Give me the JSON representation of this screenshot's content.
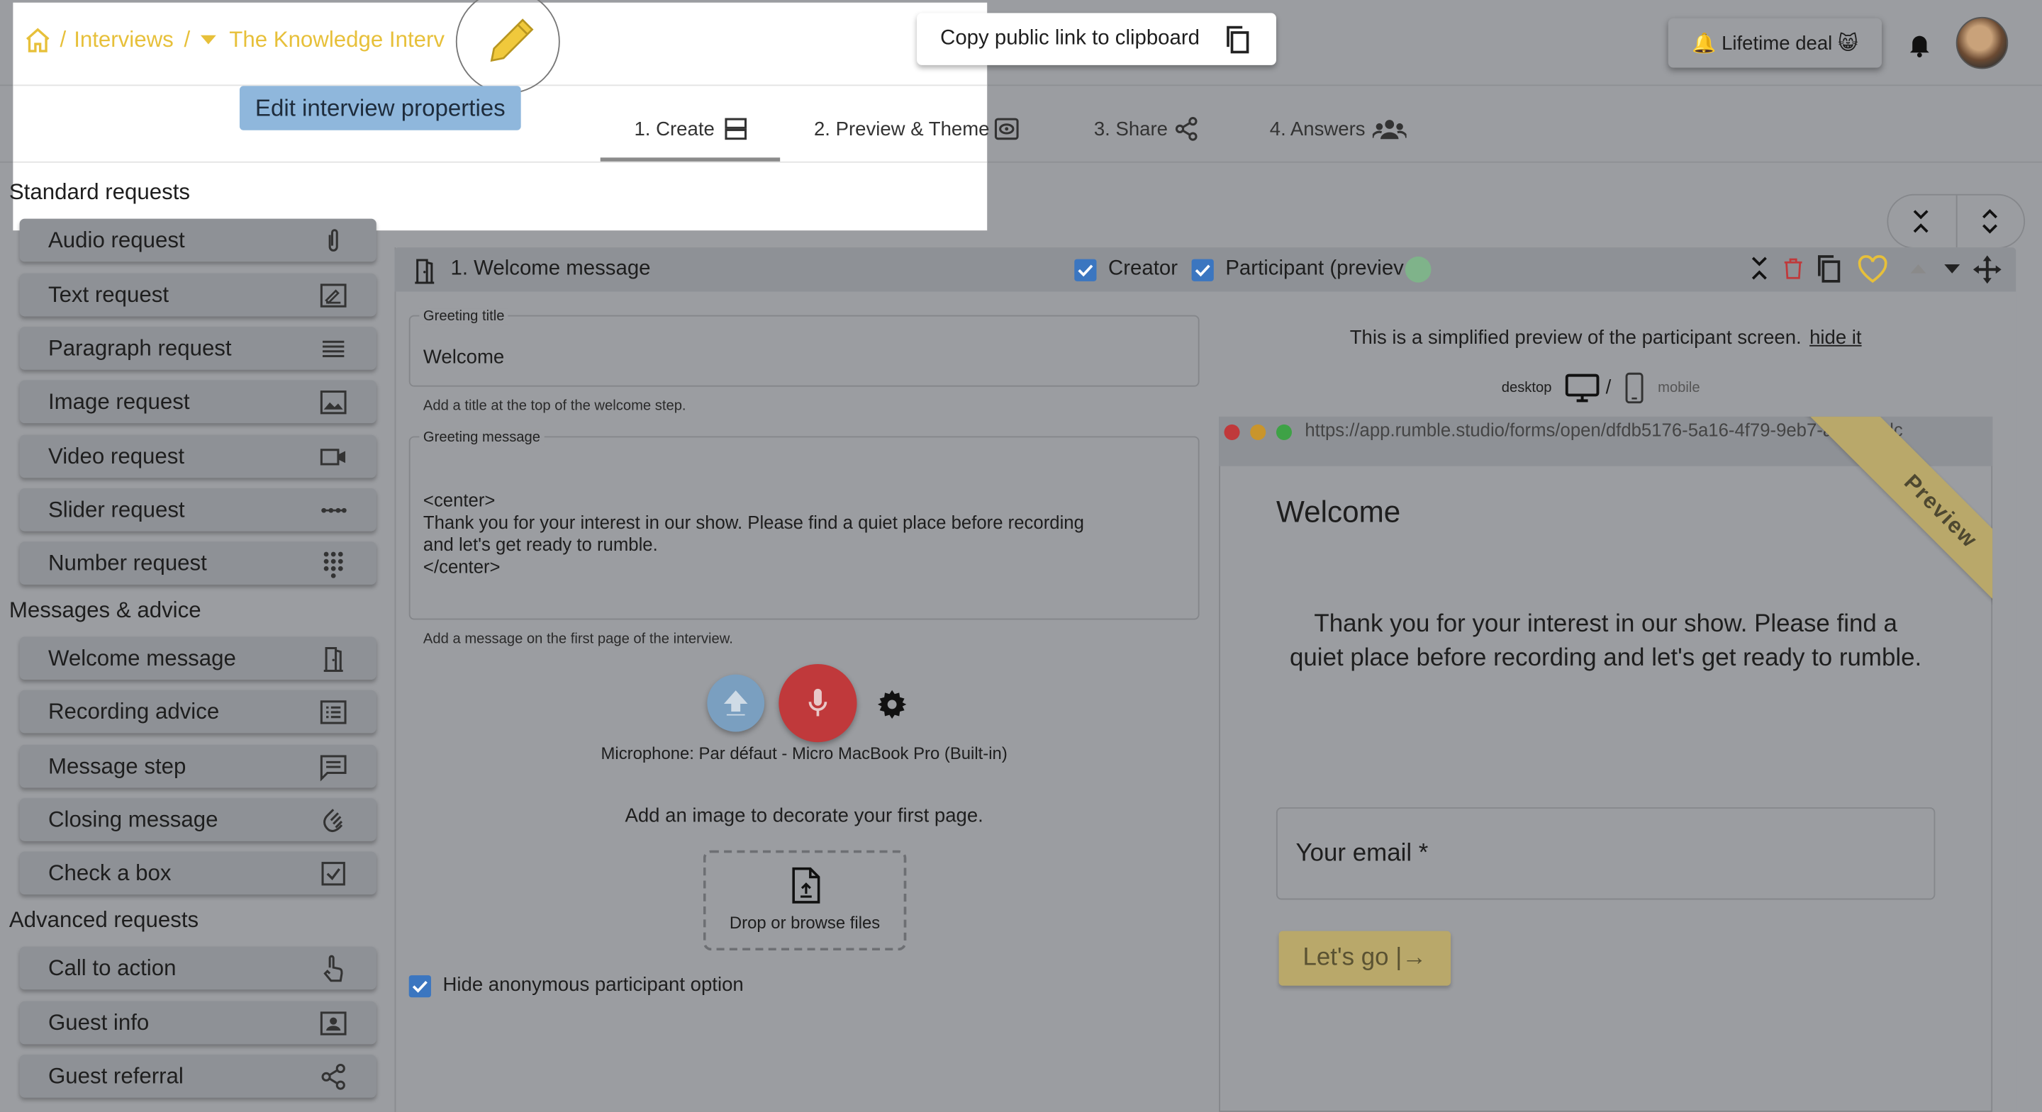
{
  "breadcrumb": {
    "home_icon": "home-icon",
    "interviews": "Interviews",
    "sep": "/",
    "current": "The Knowledge Interv"
  },
  "tooltip": "Edit interview properties",
  "header": {
    "copy_link": "Copy public link to clipboard",
    "lifetime_deal": "🔔 Lifetime deal 😸"
  },
  "tabs": [
    {
      "label": "1. Create",
      "icon": "form-icon",
      "active": true
    },
    {
      "label": "2. Preview & Theme",
      "icon": "eye-icon"
    },
    {
      "label": "3. Share",
      "icon": "share-icon"
    },
    {
      "label": "4. Answers",
      "icon": "users-icon"
    }
  ],
  "sidebar": {
    "standard_title": "Standard requests",
    "standard": [
      {
        "label": "Audio request",
        "icon": "paperclip-icon"
      },
      {
        "label": "Text request",
        "icon": "text-edit-icon"
      },
      {
        "label": "Paragraph request",
        "icon": "lines-icon"
      },
      {
        "label": "Image request",
        "icon": "image-icon"
      },
      {
        "label": "Video request",
        "icon": "video-icon"
      },
      {
        "label": "Slider request",
        "icon": "slider-icon"
      },
      {
        "label": "Number request",
        "icon": "dialpad-icon"
      }
    ],
    "messages_title": "Messages & advice",
    "messages": [
      {
        "label": "Welcome message",
        "icon": "door-icon"
      },
      {
        "label": "Recording advice",
        "icon": "list-icon"
      },
      {
        "label": "Message step",
        "icon": "message-icon"
      },
      {
        "label": "Closing message",
        "icon": "wave-hand-icon"
      },
      {
        "label": "Check a box",
        "icon": "checkbox-icon"
      }
    ],
    "advanced_title": "Advanced requests",
    "advanced": [
      {
        "label": "Call to action",
        "icon": "pointer-icon"
      },
      {
        "label": "Guest info",
        "icon": "contact-icon"
      },
      {
        "label": "Guest referral",
        "icon": "share-icon"
      }
    ]
  },
  "step": {
    "title": "1. Welcome message",
    "creator": "Creator",
    "participant": "Participant (previev",
    "greeting_title_label": "Greeting title",
    "greeting_title_value": "Welcome",
    "greeting_title_help": "Add a title at the top of the welcome step.",
    "greeting_message_label": "Greeting message",
    "greeting_message_lines": [
      "<center>",
      "Thank you for your interest in our show. Please find a quiet place before recording",
      "and let's get ready to rumble.",
      "</center>"
    ],
    "greeting_message_help": "Add a message on the first page of the interview.",
    "microphone": "Microphone: Par défaut - Micro MacBook Pro (Built-in)",
    "add_image": "Add an image to decorate your first page.",
    "drop": "Drop or browse files",
    "hide_anonymous": "Hide anonymous participant option"
  },
  "preview": {
    "note": "This is a simplified preview of the participant screen.",
    "hide_link": "hide it",
    "desktop": "desktop",
    "slash": "/",
    "mobile": "mobile",
    "url": "https://app.rumble.studio/forms/open/dfdb5176-5a16-4f79-9eb7-a38f4fedc",
    "ribbon": "Preview",
    "welcome": "Welcome",
    "message": "Thank you for your interest in our show. Please find a quiet place before recording and let's get ready to rumble.",
    "email_placeholder": "Your email *",
    "go_button": "Let's go |→"
  },
  "colors": {
    "accent_yellow": "#e7c03a",
    "checkbox_blue": "#3b76c0",
    "record_red": "#c0393b",
    "upload_blue": "#7a9fc0"
  }
}
